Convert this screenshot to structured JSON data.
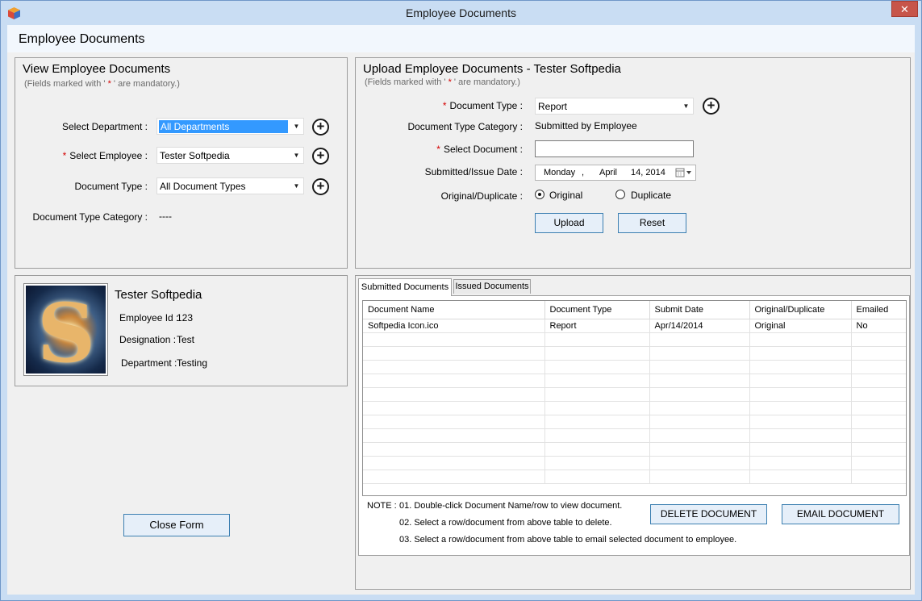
{
  "window": {
    "title": "Employee Documents",
    "close_glyph": "✕"
  },
  "form": {
    "heading": "Employee Documents"
  },
  "view_panel": {
    "title": "View Employee Documents",
    "mandatory_note_pre": "(Fields marked with '",
    "mandatory_note_star": " * ",
    "mandatory_note_post": "' are mandatory.)",
    "department_label": "Select Department :",
    "department_value": "All Departments",
    "employee_label": "Select Employee :",
    "employee_value": "Tester  Softpedia",
    "doctype_label": "Document Type :",
    "doctype_value": "All Document Types",
    "category_label": "Document Type Category :",
    "category_value": "----"
  },
  "upload_panel": {
    "title": "Upload Employee Documents - Tester  Softpedia",
    "mandatory_note_pre": "(Fields marked with '",
    "mandatory_note_star": " * ",
    "mandatory_note_post": "' are mandatory.)",
    "doctype_label": "Document Type :",
    "doctype_value": "Report",
    "category_label": "Document Type Category :",
    "category_value": "Submitted by Employee",
    "select_doc_label": "Select Document :",
    "select_doc_value": "",
    "date_label": "Submitted/Issue Date :",
    "date_day": "Monday",
    "date_sep": ",",
    "date_month": "April",
    "date_rest": "14, 2014",
    "orig_dup_label": "Original/Duplicate :",
    "option_original": "Original",
    "option_duplicate": "Duplicate",
    "selected_option": "Original",
    "upload_button": "Upload",
    "reset_button": "Reset"
  },
  "employee_card": {
    "name": "Tester  Softpedia",
    "id_label": "Employee Id :",
    "id_value": "123",
    "designation_label": "Designation :",
    "designation_value": "Test",
    "department_label": "Department :",
    "department_value": "Testing"
  },
  "close_button": "Close Form",
  "tabs": [
    {
      "label": "Submitted Documents",
      "active": true
    },
    {
      "label": "Issued Documents",
      "active": false
    }
  ],
  "grid": {
    "columns": [
      "Document Name",
      "Document Type",
      "Submit Date",
      "Original/Duplicate",
      "Emailed"
    ],
    "rows": [
      [
        "Softpedia Icon.ico",
        "Report",
        "Apr/14/2014",
        "Original",
        "No"
      ]
    ]
  },
  "notes": {
    "label": "NOTE :",
    "lines": [
      "01. Double-click Document Name/row to view document.",
      "02. Select a row/document from above table to delete.",
      "03. Select a row/document from above table to email selected document to employee."
    ]
  },
  "delete_button": "DELETE DOCUMENT",
  "email_button": "EMAIL DOCUMENT",
  "icons": {
    "add": "plus-circle-icon",
    "dropdown": "chevron-down-icon",
    "calendar": "calendar-icon"
  },
  "colors": {
    "accent": "#3399ff",
    "button_border": "#3c7fb1",
    "button_fill": "#e6eff9",
    "close_red": "#c7554a",
    "required_star": "#d40000"
  }
}
